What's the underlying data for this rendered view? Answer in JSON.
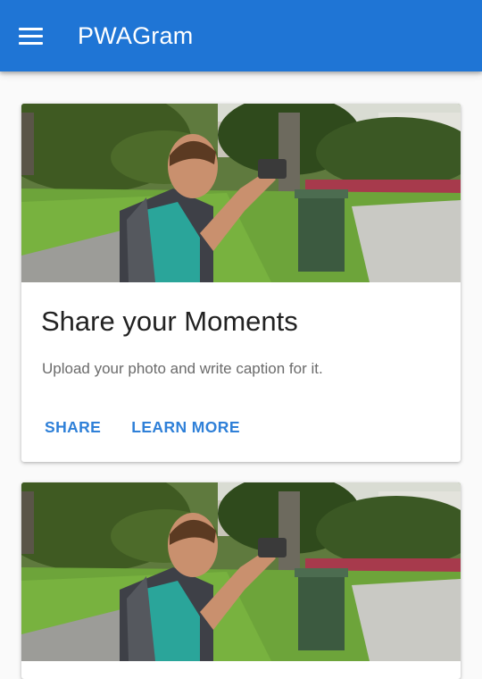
{
  "app_bar": {
    "title": "PWAGram",
    "menu_icon": "menu-icon",
    "color": "#1f75d5"
  },
  "feed": {
    "cards": [
      {
        "image": "photo-man-taking-picture-in-park",
        "title": "Share your Moments",
        "text": "Upload your photo and write caption for it.",
        "actions": [
          {
            "label": "SHARE"
          },
          {
            "label": "LEARN MORE"
          }
        ]
      },
      {
        "image": "photo-man-taking-picture-in-park"
      }
    ],
    "accent_color": "#2f80d8"
  }
}
